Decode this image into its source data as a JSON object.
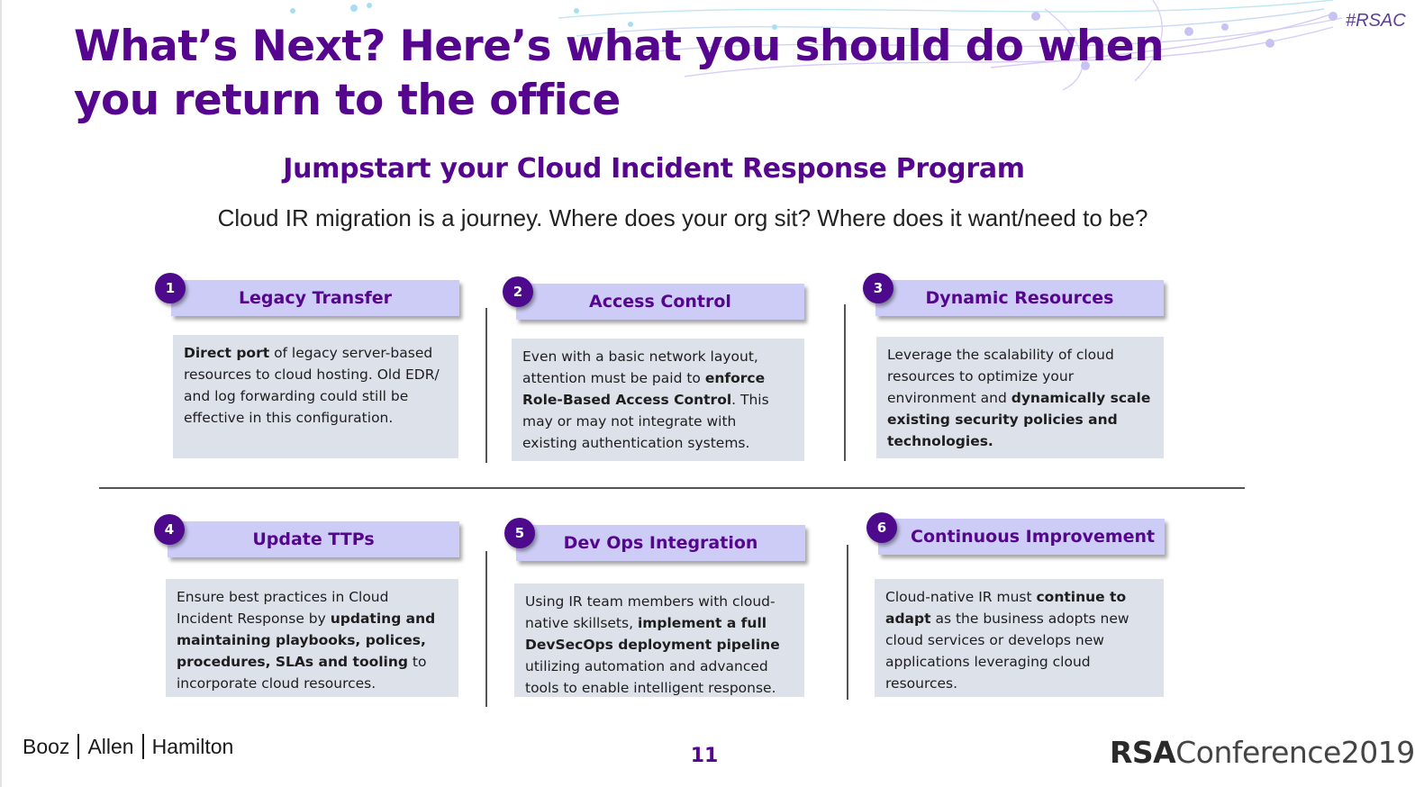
{
  "slide": {
    "hashtag": "#RSAC",
    "title": "What’s Next? Here’s what you should do when you return to the office",
    "subtitle": "Jumpstart your Cloud Incident Response Program",
    "lead": "Cloud IR migration is a journey.  Where does your org sit? Where does it want/need to be?",
    "accent_color": "#56068e",
    "badge_color": "#4e0a8c",
    "header_fill": "#ccccf6",
    "body_fill": "#dde1ea"
  },
  "cards": [
    {
      "number": "1",
      "title": "Legacy Transfer",
      "body": [
        {
          "text": "Direct port",
          "bold": true
        },
        {
          "text": " of legacy server-based resources to cloud hosting.  Old EDR/ and log forwarding could still be effective in this configuration.",
          "bold": false
        }
      ]
    },
    {
      "number": "2",
      "title": "Access Control",
      "body": [
        {
          "text": "Even with a basic network layout, attention must be paid to ",
          "bold": false
        },
        {
          "text": "enforce Role-Based Access Control",
          "bold": true
        },
        {
          "text": ".  This may or may not integrate with existing authentication systems.",
          "bold": false
        }
      ]
    },
    {
      "number": "3",
      "title": "Dynamic Resources",
      "body": [
        {
          "text": "Leverage the scalability of cloud resources to optimize your environment and ",
          "bold": false
        },
        {
          "text": "dynamically scale existing security policies and technologies.",
          "bold": true
        }
      ]
    },
    {
      "number": "4",
      "title": "Update TTPs",
      "body": [
        {
          "text": "Ensure best practices in Cloud Incident Response by ",
          "bold": false
        },
        {
          "text": "updating and maintaining playbooks, polices, procedures, SLAs and tooling",
          "bold": true
        },
        {
          "text": " to incorporate cloud resources.",
          "bold": false
        }
      ]
    },
    {
      "number": "5",
      "title": "Dev Ops Integration",
      "body": [
        {
          "text": "Using IR team members with cloud-native skillsets, ",
          "bold": false
        },
        {
          "text": "implement a full DevSecOps deployment pipeline",
          "bold": true
        },
        {
          "text": " utilizing automation and advanced tools to enable intelligent response.",
          "bold": false
        }
      ]
    },
    {
      "number": "6",
      "title": "Continuous Improvement",
      "body": [
        {
          "text": "Cloud-native IR must ",
          "bold": false
        },
        {
          "text": "continue to adapt",
          "bold": true
        },
        {
          "text": " as the business adopts new cloud services or develops new applications leveraging cloud resources.",
          "bold": false
        }
      ]
    }
  ],
  "footer": {
    "company_parts": [
      "Booz",
      "Allen",
      "Hamilton"
    ],
    "page_number": "11",
    "conference_brand": "RSA",
    "conference_name": "Conference2019"
  }
}
